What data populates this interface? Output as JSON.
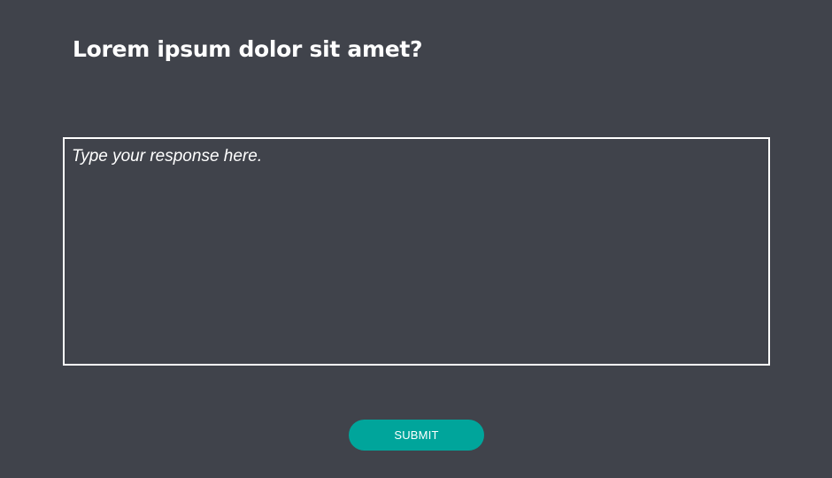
{
  "question": {
    "text": "Lorem ipsum dolor sit amet?"
  },
  "response": {
    "placeholder": "Type your response here.",
    "value": ""
  },
  "submit": {
    "label": "SUBMIT"
  },
  "colors": {
    "background": "#40434b",
    "accent": "#00a59b",
    "text": "#ffffff",
    "border": "#ffffff"
  }
}
